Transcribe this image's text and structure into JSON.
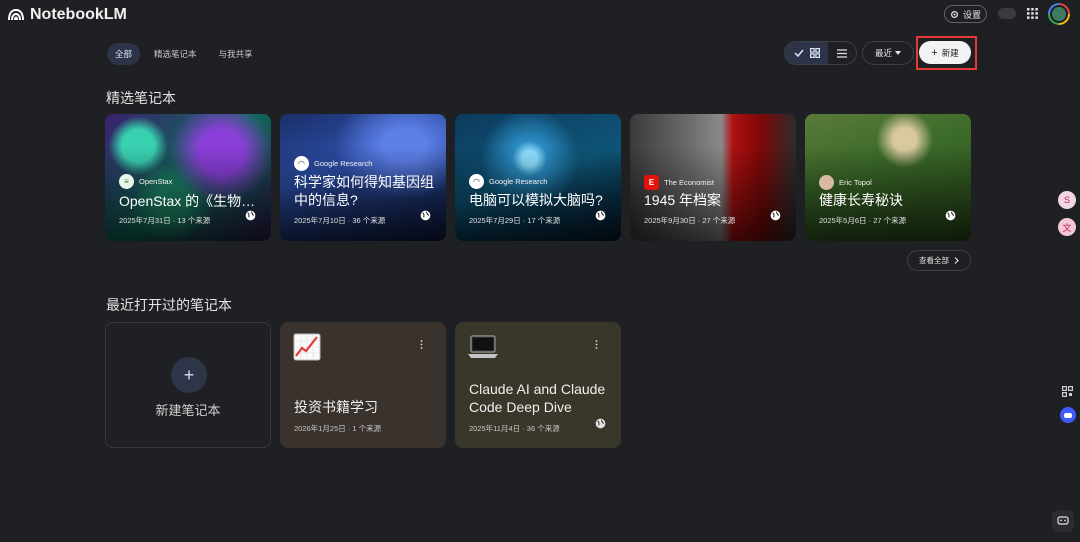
{
  "app": {
    "name": "NotebookLM"
  },
  "header": {
    "settings_label": "设置"
  },
  "tabs": [
    {
      "label": "全部",
      "active": true
    },
    {
      "label": "精选笔记本",
      "active": false
    },
    {
      "label": "与我共享",
      "active": false
    }
  ],
  "toolbar": {
    "sort_label": "最近",
    "new_label": "新建",
    "view_mode": "grid"
  },
  "featured": {
    "title": "精选笔记本",
    "view_all_label": "查看全部",
    "cards": [
      {
        "source": "OpenStax",
        "title": "OpenStax 的《生物…",
        "meta": "2025年7月31日 · 13 个来源",
        "icon": "globe-icon"
      },
      {
        "source": "Google Research",
        "title": "科学家如何得知基因组中的信息?",
        "meta": "2025年7月10日 · 36 个来源",
        "icon": "globe-icon"
      },
      {
        "source": "Google Research",
        "title": "电脑可以模拟大脑吗?",
        "meta": "2025年7月29日 · 17 个来源",
        "icon": "globe-icon"
      },
      {
        "source": "The Economist",
        "title": "1945 年档案",
        "meta": "2025年9月30日 · 27 个来源",
        "icon": "globe-icon"
      },
      {
        "source": "Eric Topol",
        "title": "健康长寿秘诀",
        "meta": "2025年5月6日 · 27 个来源",
        "icon": "globe-icon"
      }
    ]
  },
  "recent": {
    "title": "最近打开过的笔记本",
    "new_notebook_label": "新建笔记本",
    "cards": [
      {
        "emoji": "chart-increasing-emoji",
        "title": "投资书籍学习",
        "meta": "2026年1月25日 · 1 个来源",
        "color": "#3a322c"
      },
      {
        "emoji": "laptop-emoji",
        "title": "Claude AI and Claude Code Deep Dive",
        "meta": "2025年11月4日 · 36 个来源",
        "color": "#39372a"
      }
    ]
  },
  "colors": {
    "background": "#1f2023",
    "accent_active": "#2e3447",
    "highlight_border": "#e53935"
  }
}
